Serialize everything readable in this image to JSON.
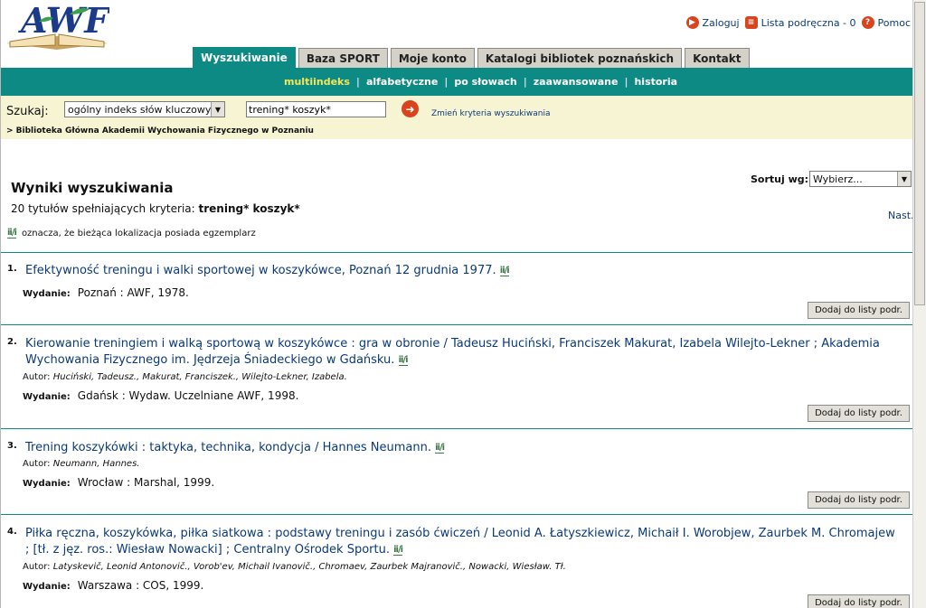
{
  "logo": {
    "text": "AWF"
  },
  "top_links": {
    "login": "Zaloguj",
    "list": "Lista podręczna - 0",
    "help": "Pomoc"
  },
  "tabs": [
    {
      "label": "Wyszukiwanie",
      "active": true
    },
    {
      "label": "Baza SPORT",
      "active": false
    },
    {
      "label": "Moje konto",
      "active": false
    },
    {
      "label": "Katalogi bibliotek poznańskich",
      "active": false
    },
    {
      "label": "Kontakt",
      "active": false
    }
  ],
  "subnav": [
    "multiindeks",
    "alfabetyczne",
    "po słowach",
    "zaawansowane",
    "historia"
  ],
  "search": {
    "label": "Szukaj:",
    "index": "ogólny indeks słów kluczowych",
    "query": "trening* koszyk*",
    "change": "Zmień kryteria wyszukiwania",
    "breadcrumb": "> Biblioteka Główna Akademii Wychowania Fizycznego w Poznaniu"
  },
  "results": {
    "title": "Wyniki wyszukiwania",
    "count_text": "20 tytułów spełniających kryteria:",
    "query": "trening* koszyk*",
    "next": "Nast.",
    "legend": "oznacza, że bieżąca lokalizacja posiada egzemplarz",
    "holding_icon": "ii/i"
  },
  "sort": {
    "label": "Sortuj wg:",
    "value": "Wybierz..."
  },
  "labels": {
    "author": "Autor:",
    "edition": "Wydanie:",
    "add": "Dodaj do listy podr."
  },
  "records": [
    {
      "num": "1.",
      "title": "Efektywność treningu i walki sportowej w koszykówce, Poznań 12 grudnia 1977.",
      "author": "",
      "pub": "Poznań : AWF, 1978."
    },
    {
      "num": "2.",
      "title": "Kierowanie treningiem i walką sportową w koszykówce : gra w obronie / Tadeusz Huciński, Franciszek Makurat, Izabela Wilejto-Lekner ; Akademia Wychowania Fizycznego im. Jędrzeja Śniadeckiego w Gdańsku.",
      "author": "Huciński, Tadeusz., Makurat, Franciszek., Wilejto-Lekner, Izabela.",
      "pub": "Gdańsk : Wydaw. Uczelniane AWF, 1998."
    },
    {
      "num": "3.",
      "title": "Trening koszykówki : taktyka, technika, kondycja / Hannes Neumann.",
      "author": "Neumann, Hannes.",
      "pub": "Wrocław : Marshal, 1999."
    },
    {
      "num": "4.",
      "title": "Piłka ręczna, koszykówka, piłka siatkowa : podstawy treningu i zasób ćwiczeń / Leonid A. Łatyszkiewicz, Michaił I. Worobjew, Zaurbek M. Chromajew ; [tł. z jęz. ros.: Wiesław Nowacki] ; Centralny Ośrodek Sportu.",
      "author": "Latyskevič, Leonid Antonovič., Vorob'ev, Michail Ivanovič., Chromaev, Zaurbek Majranovič., Nowacki, Wiesław. Tł.",
      "pub": "Warszawa : COS, 1999."
    }
  ],
  "colors": {
    "teal": "#0e8a84",
    "link": "#0a3a7a",
    "search_bg": "#f6f4d3"
  }
}
